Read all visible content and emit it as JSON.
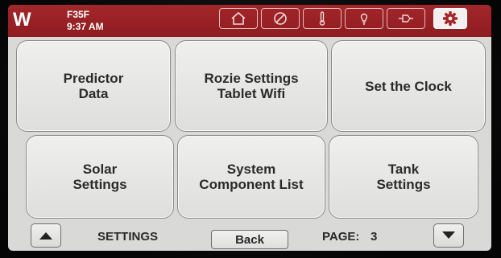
{
  "header": {
    "logo": "W",
    "model": "F35F",
    "time": "9:37 AM",
    "nav": [
      {
        "name": "home-icon"
      },
      {
        "name": "no-symbol-icon"
      },
      {
        "name": "thermometer-icon"
      },
      {
        "name": "lightbulb-icon"
      },
      {
        "name": "plug-icon"
      },
      {
        "name": "gear-icon",
        "active": true
      }
    ],
    "accent_color": "#9a2226"
  },
  "tiles": [
    {
      "label": "Predictor\nData"
    },
    {
      "label": "Rozie Settings\nTablet Wifi"
    },
    {
      "label": "Set the Clock"
    },
    {
      "label": "Solar\nSettings"
    },
    {
      "label": "System\nComponent List"
    },
    {
      "label": "Tank\nSettings"
    }
  ],
  "footer": {
    "section_label": "SETTINGS",
    "back_label": "Back",
    "page_label": "PAGE:",
    "page_number": "3"
  }
}
